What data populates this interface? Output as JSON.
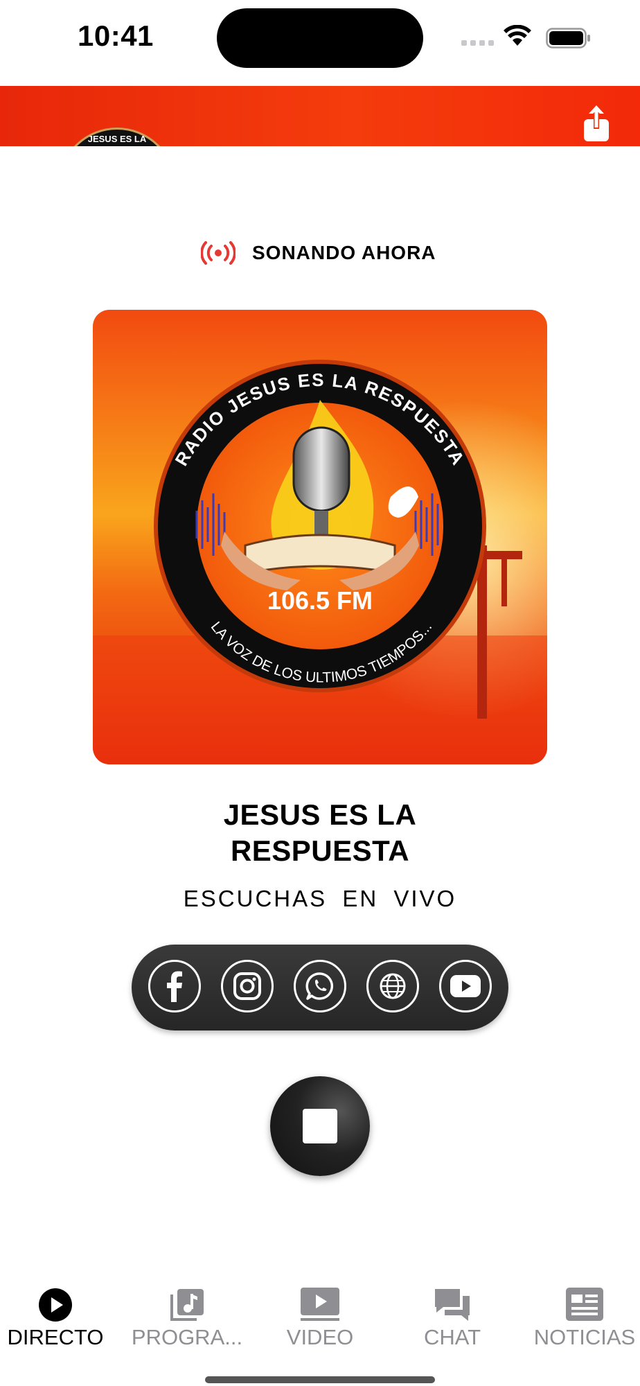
{
  "status_bar": {
    "time": "10:41"
  },
  "header": {
    "logo_text": "JESUS ES LA RESPUESTA",
    "share_icon": "share-icon"
  },
  "now_playing": {
    "label": "SONANDO AHORA",
    "icon": "broadcast-icon",
    "accent": "#e53935"
  },
  "artwork": {
    "arc_top": "RADIO JESUS ES LA RESPUESTA",
    "frequency": "106.5 FM",
    "arc_bottom": "LA VOZ DE LOS ULTIMOS TIEMPOS..."
  },
  "station": {
    "title_line1": "JESUS ES LA",
    "title_line2": "RESPUESTA",
    "subtitle": "ESCUCHAS EN VIVO"
  },
  "social": [
    {
      "name": "facebook",
      "icon": "facebook-icon"
    },
    {
      "name": "instagram",
      "icon": "instagram-icon"
    },
    {
      "name": "whatsapp",
      "icon": "whatsapp-icon"
    },
    {
      "name": "website",
      "icon": "globe-icon"
    },
    {
      "name": "youtube",
      "icon": "youtube-icon"
    }
  ],
  "player": {
    "state_icon": "stop-icon"
  },
  "tabs": [
    {
      "label": "DIRECTO",
      "icon": "play-circle-icon",
      "active": true
    },
    {
      "label": "PROGRA...",
      "icon": "music-library-icon",
      "active": false
    },
    {
      "label": "VIDEO",
      "icon": "video-icon",
      "active": false
    },
    {
      "label": "CHAT",
      "icon": "chat-icon",
      "active": false
    },
    {
      "label": "NOTICIAS",
      "icon": "news-icon",
      "active": false
    }
  ],
  "colors": {
    "brand": "#f2320c",
    "tab_inactive": "#8e8e93",
    "dark": "#2a2a2a"
  }
}
